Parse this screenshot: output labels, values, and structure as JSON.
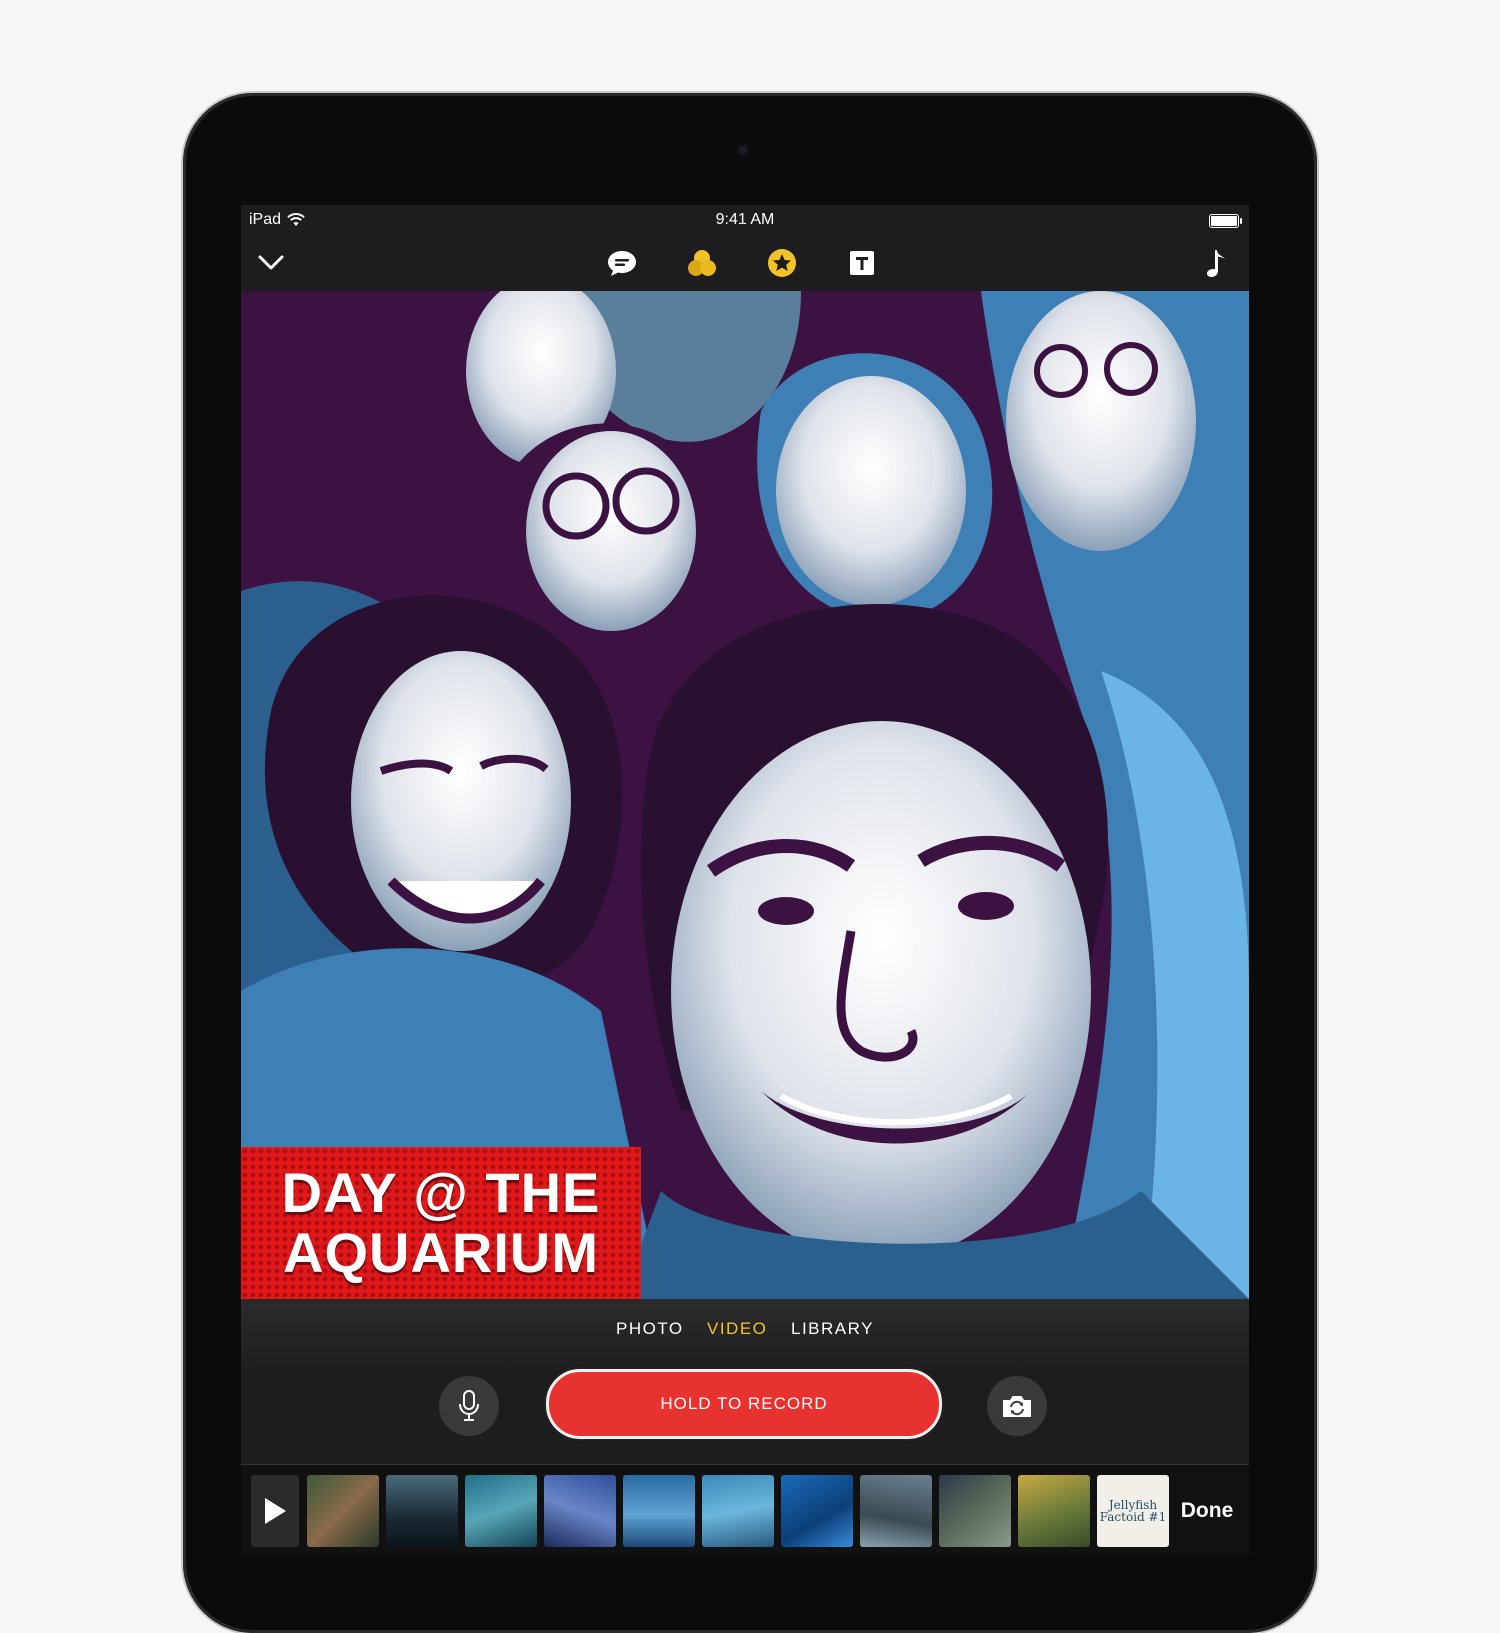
{
  "status_bar": {
    "device": "iPad",
    "time": "9:41 AM"
  },
  "toolbar": {
    "collapse_icon": "chevron-down-icon",
    "buttons": [
      {
        "name": "speech-bubble-icon",
        "color": "#ffffff"
      },
      {
        "name": "filters-icon",
        "color": "#f2c228"
      },
      {
        "name": "stickers-star-icon",
        "color": "#f2c228"
      },
      {
        "name": "text-icon",
        "color": "#ffffff"
      }
    ],
    "music_icon": "music-note-icon"
  },
  "title_card": {
    "line1": "DAY @ THE",
    "line2": "AQUARIUM",
    "background_color": "#e01818"
  },
  "modes": {
    "items": [
      "PHOTO",
      "VIDEO",
      "LIBRARY"
    ],
    "active": "VIDEO",
    "active_color": "#f2c228"
  },
  "record": {
    "label": "HOLD TO RECORD",
    "color": "#e8322f"
  },
  "timeline": {
    "text_clip_label": "Jellyfish Factoid #1",
    "done_label": "Done"
  }
}
